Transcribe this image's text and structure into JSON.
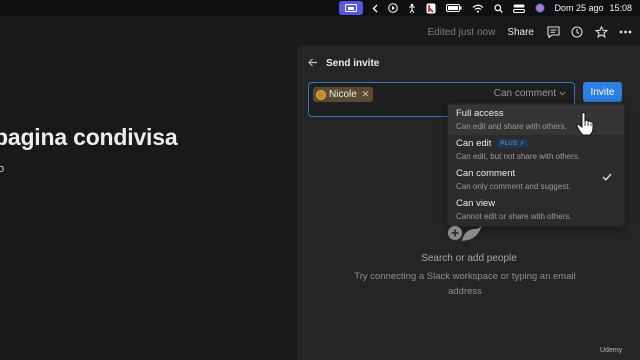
{
  "menubar": {
    "date": "Dom 25 ago",
    "time": "15:08"
  },
  "topbar": {
    "edited": "Edited just now",
    "share": "Share"
  },
  "page": {
    "title_fragment": "pagina condivisa",
    "subtitle_fragment": "o"
  },
  "share_panel": {
    "title": "Send invite",
    "chip_name": "Nicole",
    "permission_value": "Can comment",
    "invite_button": "Invite",
    "menu": [
      {
        "label": "Full access",
        "description": "Can edit and share with others.",
        "badge": "",
        "selected": false
      },
      {
        "label": "Can edit",
        "description": "Can edit, but not share with others.",
        "badge": "PLUS ↗",
        "selected": false
      },
      {
        "label": "Can comment",
        "description": "Can only comment and suggest.",
        "badge": "",
        "selected": true
      },
      {
        "label": "Can view",
        "description": "Cannot edit or share with others.",
        "badge": "",
        "selected": false
      }
    ],
    "empty_title": "Search or add people",
    "empty_description": "Try connecting a Slack workspace or typing an email address"
  },
  "watermark": "Udemy",
  "colors": {
    "accent": "#2d7fe0",
    "focus_border": "#2f78c8",
    "menubar_active": "#5b54e0",
    "background": "#191919",
    "panel": "#252525"
  },
  "icons": [
    "screen-mirroring-icon",
    "chevron-left-icon",
    "play-circle-icon",
    "accessibility-icon",
    "app-icon",
    "battery-icon",
    "wifi-icon",
    "search-icon",
    "control-center-icon",
    "siri-icon",
    "comment-icon",
    "clock-icon",
    "star-icon",
    "more-icon",
    "back-arrow-icon",
    "checkmark-icon",
    "add-person-icon",
    "hand-cursor-icon"
  ]
}
